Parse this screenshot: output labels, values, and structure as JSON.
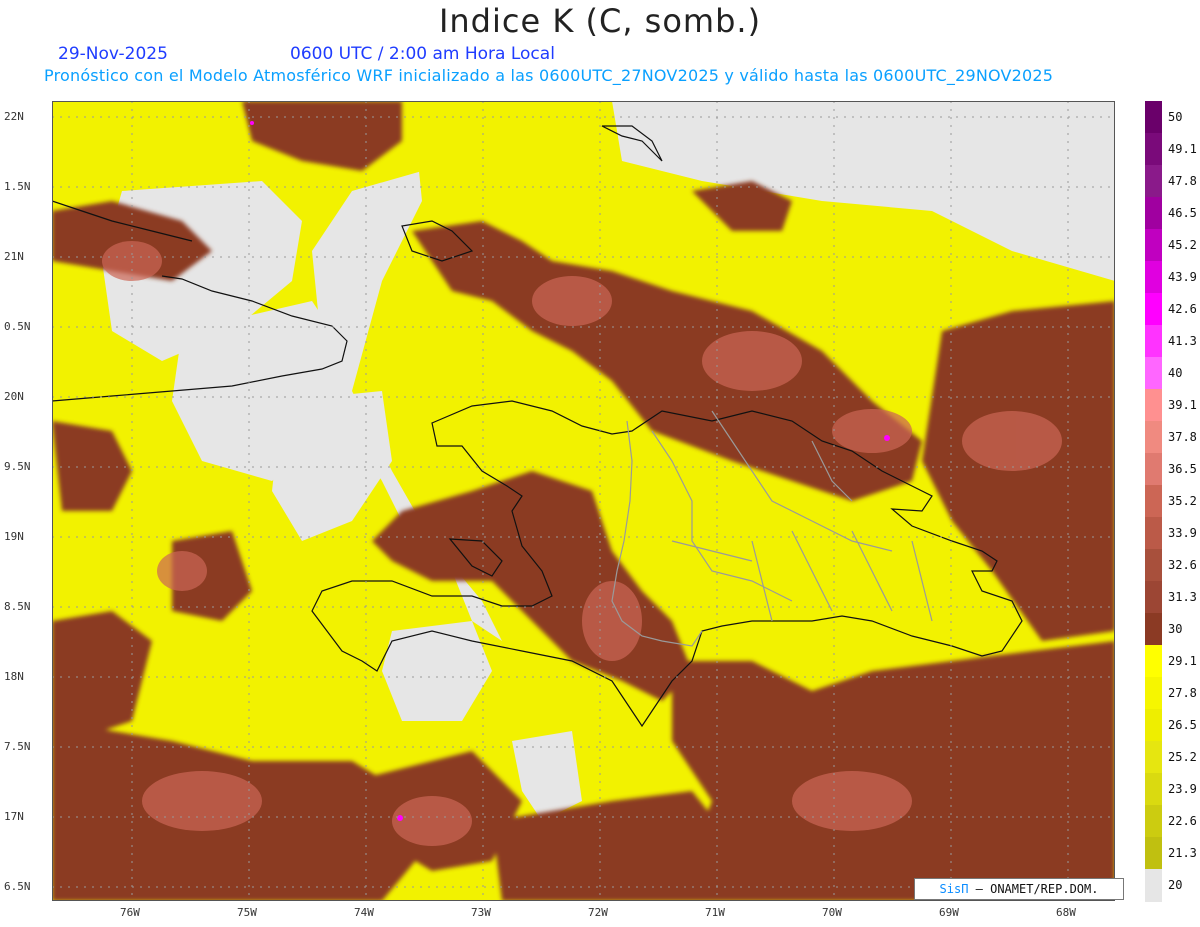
{
  "header": {
    "title": "Indice K (C, somb.)",
    "date": "29-Nov-2025",
    "time": "0600 UTC / 2:00 am Hora Local",
    "subtitle": "Pronóstico con el Modelo Atmosférico WRF inicializado a las 0600UTC_27NOV2025 y válido hasta las  0600UTC_29NOV2025"
  },
  "map": {
    "lat_labels": [
      "22N",
      "1.5N",
      "21N",
      "0.5N",
      "20N",
      "9.5N",
      "19N",
      "8.5N",
      "18N",
      "7.5N",
      "17N",
      "6.5N"
    ],
    "lon_labels": [
      "76W",
      "75W",
      "74W",
      "73W",
      "72W",
      "71W",
      "70W",
      "69W",
      "68W"
    ],
    "credit": {
      "sis": "SisΠ",
      "rest": " – ONAMET/REP.DOM."
    }
  },
  "colorbar": {
    "labels": [
      "50",
      "49.1",
      "47.8",
      "46.5",
      "45.2",
      "43.9",
      "42.6",
      "41.3",
      "40",
      "39.1",
      "37.8",
      "36.5",
      "35.2",
      "33.9",
      "32.6",
      "31.3",
      "30",
      "29.1",
      "27.8",
      "26.5",
      "25.2",
      "23.9",
      "22.6",
      "21.3",
      "20"
    ],
    "colors": [
      "#6a006a",
      "#7a0a7a",
      "#8a1a8a",
      "#a000a0",
      "#c000c0",
      "#e000e0",
      "#ff00ff",
      "#ff33ff",
      "#ff66ff",
      "#ff9090",
      "#f08a80",
      "#e07a70",
      "#cc6655",
      "#bb5a48",
      "#a8503c",
      "#9c4634",
      "#8b3a24",
      "#ffff00",
      "#f6f600",
      "#eeee00",
      "#e6e610",
      "#dada10",
      "#cccc10",
      "#c0c010",
      "#e6e6e6"
    ]
  }
}
